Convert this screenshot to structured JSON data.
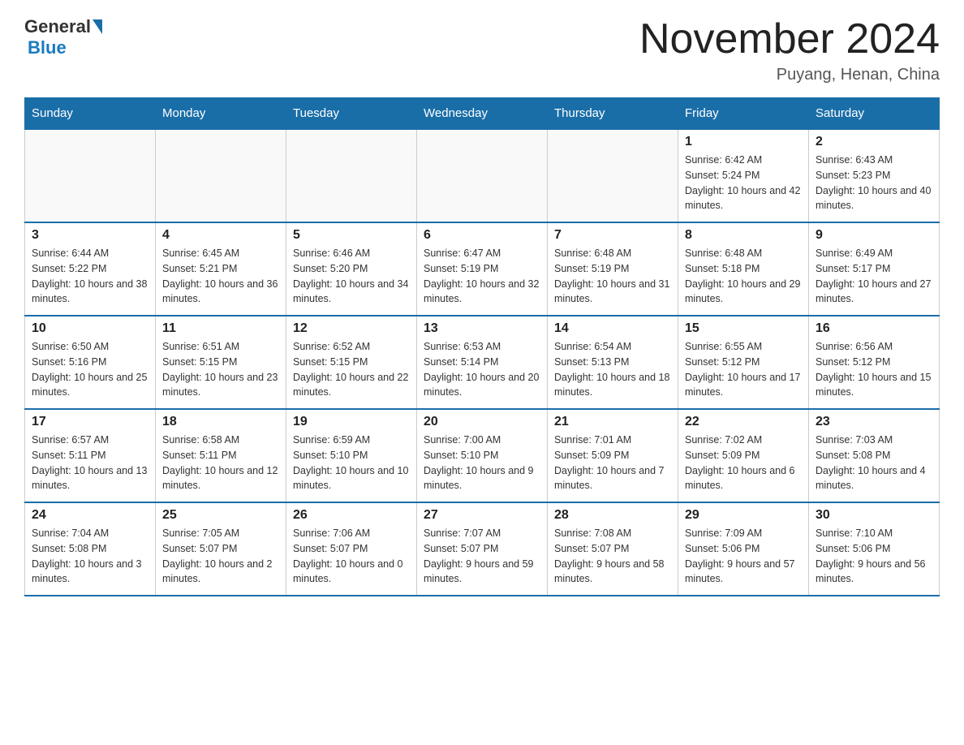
{
  "header": {
    "logo_general": "General",
    "logo_blue": "Blue",
    "month_title": "November 2024",
    "location": "Puyang, Henan, China"
  },
  "days_of_week": [
    "Sunday",
    "Monday",
    "Tuesday",
    "Wednesday",
    "Thursday",
    "Friday",
    "Saturday"
  ],
  "weeks": [
    [
      {
        "day": "",
        "info": ""
      },
      {
        "day": "",
        "info": ""
      },
      {
        "day": "",
        "info": ""
      },
      {
        "day": "",
        "info": ""
      },
      {
        "day": "",
        "info": ""
      },
      {
        "day": "1",
        "info": "Sunrise: 6:42 AM\nSunset: 5:24 PM\nDaylight: 10 hours and 42 minutes."
      },
      {
        "day": "2",
        "info": "Sunrise: 6:43 AM\nSunset: 5:23 PM\nDaylight: 10 hours and 40 minutes."
      }
    ],
    [
      {
        "day": "3",
        "info": "Sunrise: 6:44 AM\nSunset: 5:22 PM\nDaylight: 10 hours and 38 minutes."
      },
      {
        "day": "4",
        "info": "Sunrise: 6:45 AM\nSunset: 5:21 PM\nDaylight: 10 hours and 36 minutes."
      },
      {
        "day": "5",
        "info": "Sunrise: 6:46 AM\nSunset: 5:20 PM\nDaylight: 10 hours and 34 minutes."
      },
      {
        "day": "6",
        "info": "Sunrise: 6:47 AM\nSunset: 5:19 PM\nDaylight: 10 hours and 32 minutes."
      },
      {
        "day": "7",
        "info": "Sunrise: 6:48 AM\nSunset: 5:19 PM\nDaylight: 10 hours and 31 minutes."
      },
      {
        "day": "8",
        "info": "Sunrise: 6:48 AM\nSunset: 5:18 PM\nDaylight: 10 hours and 29 minutes."
      },
      {
        "day": "9",
        "info": "Sunrise: 6:49 AM\nSunset: 5:17 PM\nDaylight: 10 hours and 27 minutes."
      }
    ],
    [
      {
        "day": "10",
        "info": "Sunrise: 6:50 AM\nSunset: 5:16 PM\nDaylight: 10 hours and 25 minutes."
      },
      {
        "day": "11",
        "info": "Sunrise: 6:51 AM\nSunset: 5:15 PM\nDaylight: 10 hours and 23 minutes."
      },
      {
        "day": "12",
        "info": "Sunrise: 6:52 AM\nSunset: 5:15 PM\nDaylight: 10 hours and 22 minutes."
      },
      {
        "day": "13",
        "info": "Sunrise: 6:53 AM\nSunset: 5:14 PM\nDaylight: 10 hours and 20 minutes."
      },
      {
        "day": "14",
        "info": "Sunrise: 6:54 AM\nSunset: 5:13 PM\nDaylight: 10 hours and 18 minutes."
      },
      {
        "day": "15",
        "info": "Sunrise: 6:55 AM\nSunset: 5:12 PM\nDaylight: 10 hours and 17 minutes."
      },
      {
        "day": "16",
        "info": "Sunrise: 6:56 AM\nSunset: 5:12 PM\nDaylight: 10 hours and 15 minutes."
      }
    ],
    [
      {
        "day": "17",
        "info": "Sunrise: 6:57 AM\nSunset: 5:11 PM\nDaylight: 10 hours and 13 minutes."
      },
      {
        "day": "18",
        "info": "Sunrise: 6:58 AM\nSunset: 5:11 PM\nDaylight: 10 hours and 12 minutes."
      },
      {
        "day": "19",
        "info": "Sunrise: 6:59 AM\nSunset: 5:10 PM\nDaylight: 10 hours and 10 minutes."
      },
      {
        "day": "20",
        "info": "Sunrise: 7:00 AM\nSunset: 5:10 PM\nDaylight: 10 hours and 9 minutes."
      },
      {
        "day": "21",
        "info": "Sunrise: 7:01 AM\nSunset: 5:09 PM\nDaylight: 10 hours and 7 minutes."
      },
      {
        "day": "22",
        "info": "Sunrise: 7:02 AM\nSunset: 5:09 PM\nDaylight: 10 hours and 6 minutes."
      },
      {
        "day": "23",
        "info": "Sunrise: 7:03 AM\nSunset: 5:08 PM\nDaylight: 10 hours and 4 minutes."
      }
    ],
    [
      {
        "day": "24",
        "info": "Sunrise: 7:04 AM\nSunset: 5:08 PM\nDaylight: 10 hours and 3 minutes."
      },
      {
        "day": "25",
        "info": "Sunrise: 7:05 AM\nSunset: 5:07 PM\nDaylight: 10 hours and 2 minutes."
      },
      {
        "day": "26",
        "info": "Sunrise: 7:06 AM\nSunset: 5:07 PM\nDaylight: 10 hours and 0 minutes."
      },
      {
        "day": "27",
        "info": "Sunrise: 7:07 AM\nSunset: 5:07 PM\nDaylight: 9 hours and 59 minutes."
      },
      {
        "day": "28",
        "info": "Sunrise: 7:08 AM\nSunset: 5:07 PM\nDaylight: 9 hours and 58 minutes."
      },
      {
        "day": "29",
        "info": "Sunrise: 7:09 AM\nSunset: 5:06 PM\nDaylight: 9 hours and 57 minutes."
      },
      {
        "day": "30",
        "info": "Sunrise: 7:10 AM\nSunset: 5:06 PM\nDaylight: 9 hours and 56 minutes."
      }
    ]
  ]
}
